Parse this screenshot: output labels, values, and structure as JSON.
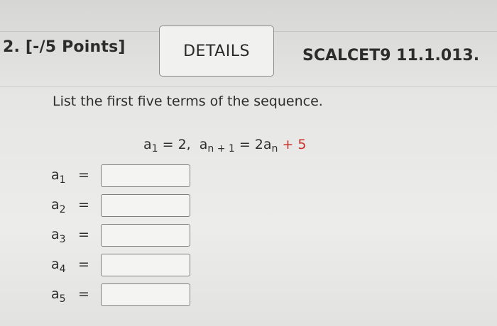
{
  "question": {
    "number": "2. [-/5 Points]",
    "details_label": "DETAILS",
    "code": "SCALCET9 11.1.013."
  },
  "prompt": "List the first five terms of the sequence.",
  "formula": {
    "a1_var": "a",
    "a1_sub": "1",
    "a1_rest": " = 2,",
    "an1_var": "a",
    "an1_sub": "n + 1",
    "eq": " = 2a",
    "an_sub": "n",
    "plus5": " + 5"
  },
  "answers": [
    {
      "var": "a",
      "sub": "1",
      "eq": "=",
      "value": ""
    },
    {
      "var": "a",
      "sub": "2",
      "eq": "=",
      "value": ""
    },
    {
      "var": "a",
      "sub": "3",
      "eq": "=",
      "value": ""
    },
    {
      "var": "a",
      "sub": "4",
      "eq": "=",
      "value": ""
    },
    {
      "var": "a",
      "sub": "5",
      "eq": "=",
      "value": ""
    }
  ],
  "colors": {
    "accent_red": "#c8302a"
  }
}
